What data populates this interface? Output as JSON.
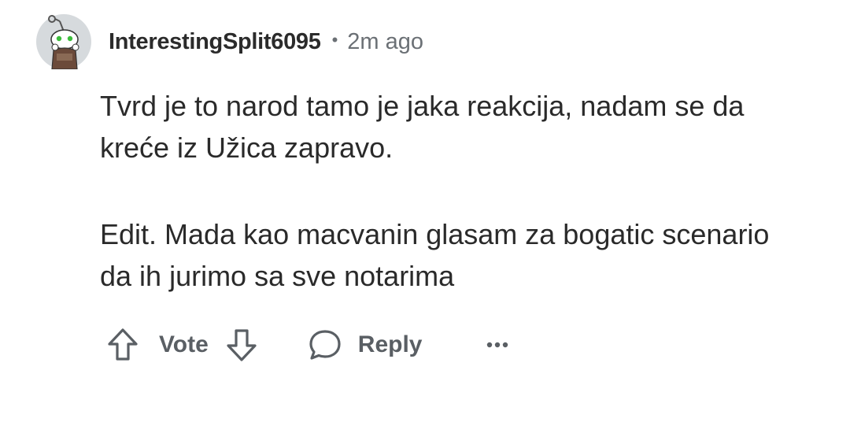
{
  "comment": {
    "author": "InterestingSplit6095",
    "separator": "•",
    "timestamp": "2m ago",
    "paragraphs": [
      "Tvrd je to narod tamo je jaka reakcija, nadam se da kreće iz Užica zapravo.",
      "Edit. Mada kao macvanin glasam za bogatic scenario da ih jurimo sa sve notarima"
    ]
  },
  "actions": {
    "vote_label": "Vote",
    "reply_label": "Reply"
  },
  "icons": {
    "avatar": "snoo-avatar-icon",
    "upvote": "arrow-up-outline-icon",
    "downvote": "arrow-down-outline-icon",
    "reply": "speech-bubble-icon",
    "more": "ellipsis-icon"
  },
  "colors": {
    "text": "#2a2a2a",
    "meta": "#6b7075",
    "action": "#5a5f64",
    "background": "#ffffff"
  }
}
